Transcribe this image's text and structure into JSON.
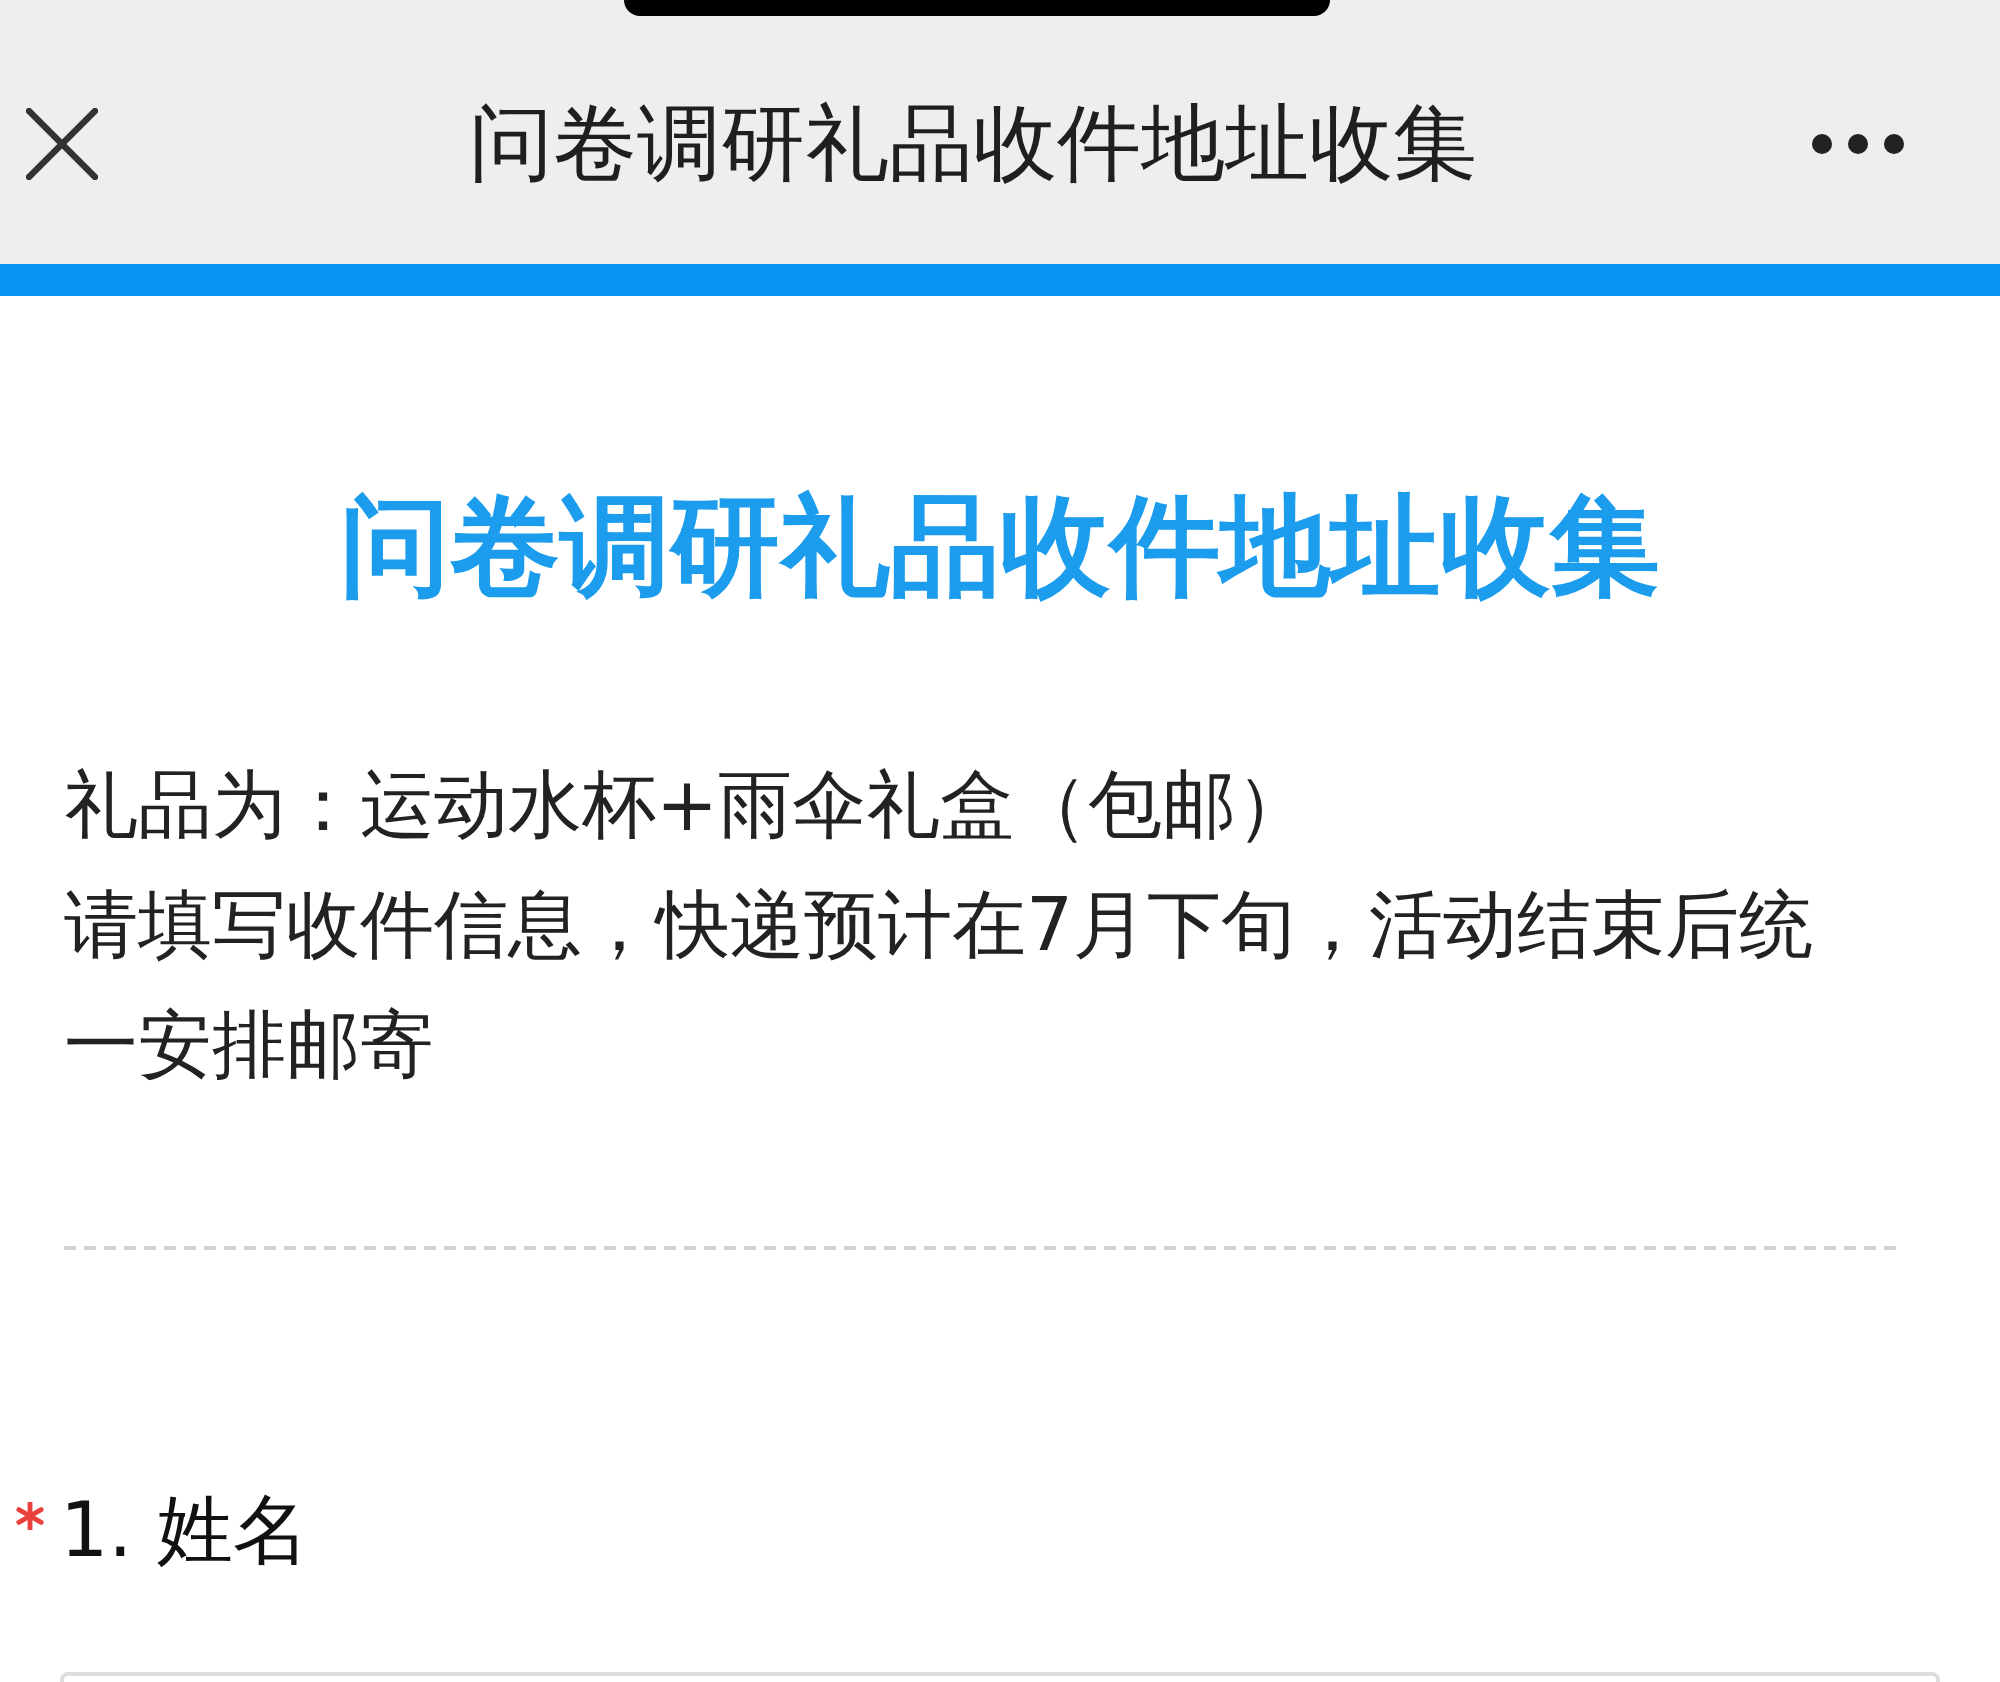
{
  "browser_bar": {
    "title": "问卷调研礼品收件地址收集"
  },
  "form": {
    "title": "问卷调研礼品收件地址收集",
    "description": [
      "礼品为：运动水杯+雨伞礼盒（包邮）",
      "请填写收件信息，快递预计在7月下旬，活动结束后统一安排邮寄"
    ],
    "questions": [
      {
        "kind": "text",
        "label": "1. 姓名",
        "required": true
      }
    ]
  }
}
